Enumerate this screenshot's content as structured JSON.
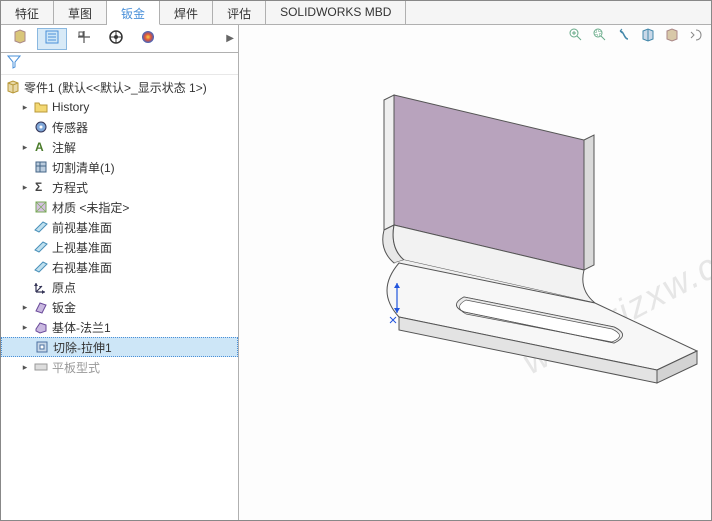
{
  "tabs": [
    {
      "label": "特征"
    },
    {
      "label": "草图"
    },
    {
      "label": "钣金",
      "active": true
    },
    {
      "label": "焊件"
    },
    {
      "label": "评估"
    },
    {
      "label": "SOLIDWORKS MBD"
    }
  ],
  "panel_tabs": [
    "feature-tree",
    "property",
    "config",
    "display",
    "appearance"
  ],
  "panel_tab_selected": 1,
  "tree_root": {
    "label": "零件1  (默认<<默认>_显示状态 1>)"
  },
  "tree_items": [
    {
      "label": "History",
      "icon": "folder",
      "expand": true
    },
    {
      "label": "传感器",
      "icon": "sensor"
    },
    {
      "label": "注解",
      "icon": "annotation",
      "expand": true
    },
    {
      "label": "切割清单(1)",
      "icon": "cutlist"
    },
    {
      "label": "方程式",
      "icon": "equation",
      "expand": true
    },
    {
      "label": "材质 <未指定>",
      "icon": "material"
    },
    {
      "label": "前视基准面",
      "icon": "plane"
    },
    {
      "label": "上视基准面",
      "icon": "plane"
    },
    {
      "label": "右视基准面",
      "icon": "plane"
    },
    {
      "label": "原点",
      "icon": "origin"
    },
    {
      "label": "钣金",
      "icon": "sheetmetal",
      "expand": true
    },
    {
      "label": "基体-法兰1",
      "icon": "flange",
      "expand": true
    },
    {
      "label": "切除-拉伸1",
      "icon": "cut",
      "selected": true
    },
    {
      "label": "平板型式",
      "icon": "flatpattern",
      "expand": true,
      "dim": true
    }
  ],
  "view_tools": [
    "zoom-fit",
    "zoom-area",
    "prev-view",
    "section",
    "display-style",
    "scene"
  ],
  "watermark": "www.rjzxw.com"
}
